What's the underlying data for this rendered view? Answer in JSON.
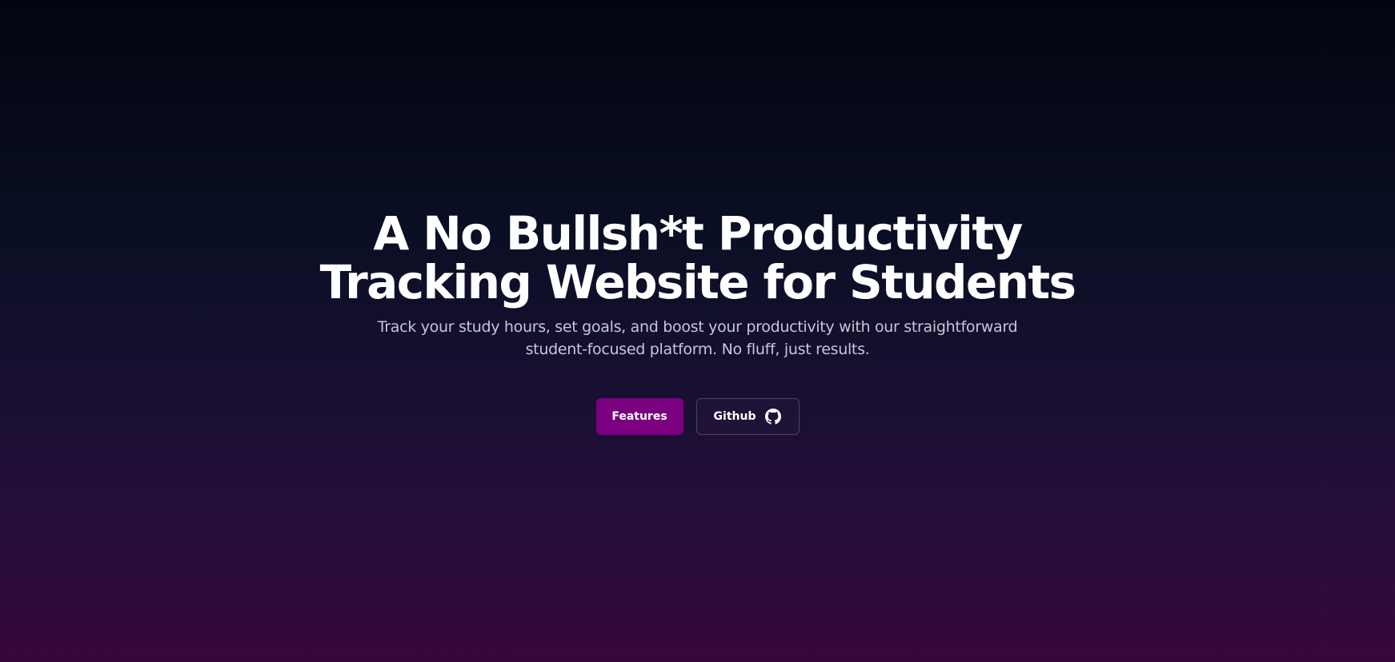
{
  "hero": {
    "title_line1": "A No Bullsh*t Productivity",
    "title_line2": "Tracking Website for Students",
    "subtitle_line1": "Track your study hours, set goals, and boost your productivity with our straightforward",
    "subtitle_line2": "student-focused platform. No fluff, just results."
  },
  "actions": {
    "features_label": "Features",
    "github_label": "Github",
    "github_icon": "github-icon"
  },
  "colors": {
    "accent": "#7a0080",
    "background_top": "#02050f",
    "background_bottom": "#38063d",
    "subtitle_text": "#c9c6d6"
  }
}
